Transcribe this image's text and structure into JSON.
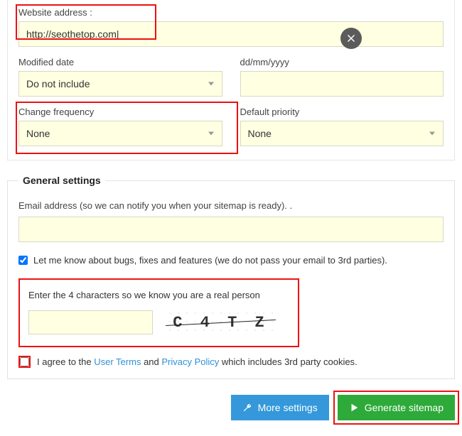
{
  "top": {
    "website_label": "Website address :",
    "website_value": "http://seothetop.com|",
    "modified_label": "Modified date",
    "modified_value": "Do not include",
    "date_format_label": "dd/mm/yyyy",
    "date_format_value": "",
    "change_freq_label": "Change frequency",
    "change_freq_value": "None",
    "default_priority_label": "Default priority",
    "default_priority_value": "None"
  },
  "general": {
    "legend": "General settings",
    "email_label": "Email address (so we can notify you when your sitemap is ready). .",
    "email_value": "",
    "notify_checked": true,
    "notify_label": "Let me know about bugs, fixes and features (we do not pass your email to 3rd parties).",
    "captcha_label": "Enter the 4 characters so we know you are a real person",
    "captcha_chars": "C 4 T Z",
    "agree_prefix": "I agree to the ",
    "agree_user_terms": "User Terms",
    "agree_and": " and ",
    "agree_privacy": "Privacy Policy",
    "agree_suffix": " which includes 3rd party cookies."
  },
  "buttons": {
    "more": "More settings",
    "generate": "Generate sitemap"
  }
}
